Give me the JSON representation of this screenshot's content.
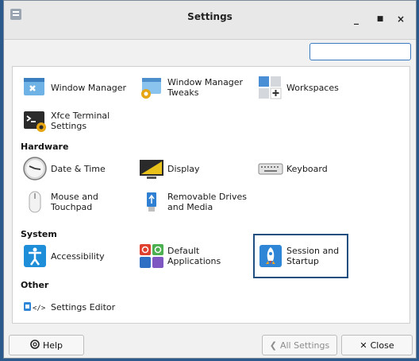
{
  "window": {
    "title": "Settings",
    "minimize": "_",
    "maximize": "■",
    "close": "×"
  },
  "search": {
    "value": "",
    "placeholder": ""
  },
  "sections": {
    "personal": {
      "items": [
        {
          "label": "Window Manager"
        },
        {
          "label": "Window Manager\nTweaks"
        },
        {
          "label": "Workspaces"
        },
        {
          "label": "Xfce Terminal\nSettings"
        }
      ]
    },
    "hardware": {
      "title": "Hardware",
      "items": [
        {
          "label": "Date & Time"
        },
        {
          "label": "Display"
        },
        {
          "label": "Keyboard"
        },
        {
          "label": "Mouse and\nTouchpad"
        },
        {
          "label": "Removable Drives\nand Media"
        }
      ]
    },
    "system": {
      "title": "System",
      "items": [
        {
          "label": "Accessibility"
        },
        {
          "label": "Default\nApplications"
        },
        {
          "label": "Session and\nStartup"
        }
      ]
    },
    "other": {
      "title": "Other",
      "items": [
        {
          "label": "Settings Editor"
        }
      ]
    }
  },
  "buttons": {
    "help": "Help",
    "all_settings": "All Settings",
    "close": "Close"
  },
  "icons": {
    "help": "help-icon",
    "all_settings": "chevron-left-icon",
    "close": "close-x-icon"
  }
}
